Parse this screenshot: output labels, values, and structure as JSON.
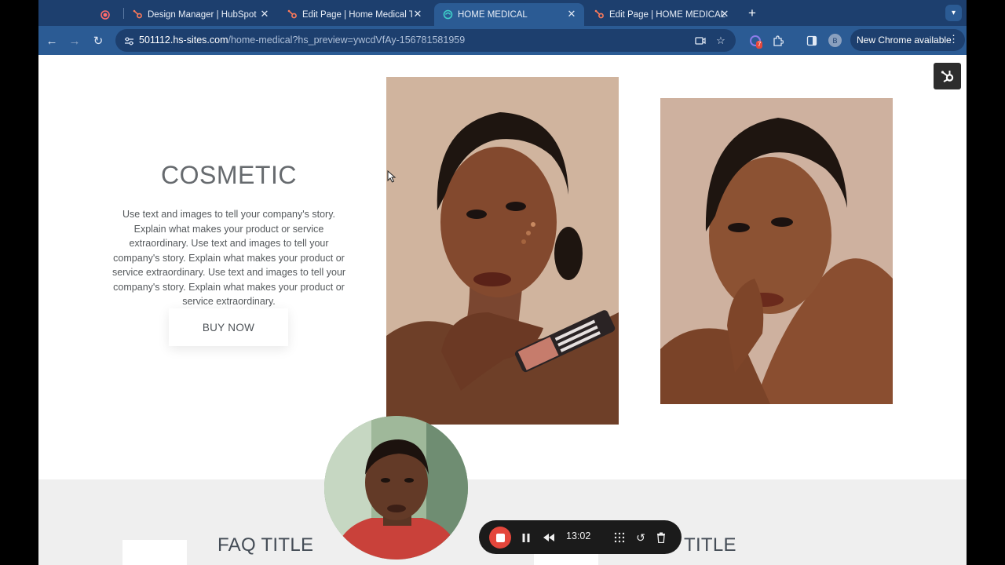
{
  "browser": {
    "tabs": [
      {
        "title": "",
        "icon": "record-icon"
      },
      {
        "title": "Design Manager | HubSpot",
        "icon": "hubspot-icon"
      },
      {
        "title": "Edit Page | Home Medical Tes",
        "icon": "hubspot-icon"
      },
      {
        "title": "HOME MEDICAL",
        "icon": "site-icon",
        "active": true
      },
      {
        "title": "Edit Page | HOME MEDICAL",
        "icon": "hubspot-icon"
      }
    ],
    "new_tab_label": "+",
    "url_host": "501112.hs-sites.com",
    "url_path": "/home-medical?hs_preview=ywcdVfAy-156781581959",
    "extension_badge": "7",
    "profile_initial": "B",
    "update_label": "New Chrome available"
  },
  "page": {
    "cosmetic_title": "COSMETIC",
    "cosmetic_body": "Use text and images to tell your company's story. Explain what makes your product or service extraordinary. Use text and images to tell your company's story. Explain what makes your product or service extraordinary. Use text and images to tell your company's story. Explain what makes your product or service extraordinary.",
    "buy_button": "BUY NOW",
    "faq_title_1": "FAQ TITLE",
    "faq_title_2": "TITLE"
  },
  "recorder": {
    "time": "13:02"
  },
  "colors": {
    "chrome_tabstrip": "#1d3f6e",
    "chrome_toolbar": "#2b5b94",
    "record_red": "#e4463b",
    "heading_gray": "#666a6e",
    "band_gray": "#efefef"
  }
}
